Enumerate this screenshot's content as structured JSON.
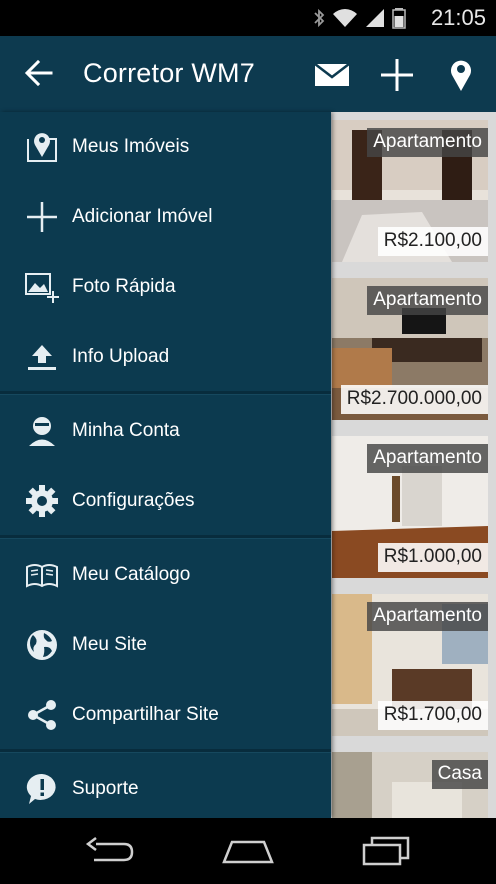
{
  "status_bar": {
    "time": "21:05"
  },
  "app_bar": {
    "title": "Corretor WM7"
  },
  "drawer": {
    "items": [
      {
        "label": "Meus Imóveis",
        "icon": "map-pin-house-icon"
      },
      {
        "label": "Adicionar Imóvel",
        "icon": "plus-icon"
      },
      {
        "label": "Foto Rápida",
        "icon": "photo-add-icon"
      },
      {
        "label": "Info Upload",
        "icon": "upload-icon"
      },
      {
        "label": "Minha Conta",
        "icon": "user-icon"
      },
      {
        "label": "Configurações",
        "icon": "gear-icon"
      },
      {
        "label": "Meu Catálogo",
        "icon": "book-icon"
      },
      {
        "label": "Meu Site",
        "icon": "globe-icon"
      },
      {
        "label": "Compartilhar Site",
        "icon": "share-icon"
      },
      {
        "label": "Suporte",
        "icon": "speech-exclamation-icon"
      }
    ]
  },
  "listings": [
    {
      "type": "Apartamento",
      "price": "R$2.100,00"
    },
    {
      "type": "Apartamento",
      "price": "R$2.700.000,00"
    },
    {
      "type": "Apartamento",
      "price": "R$1.000,00"
    },
    {
      "type": "Apartamento",
      "price": "R$1.700,00"
    },
    {
      "type": "Casa",
      "price": ""
    }
  ],
  "colors": {
    "app_bar": "#0d3a4f",
    "drawer": "#0c3a4f",
    "background": "#d9d9d9"
  }
}
